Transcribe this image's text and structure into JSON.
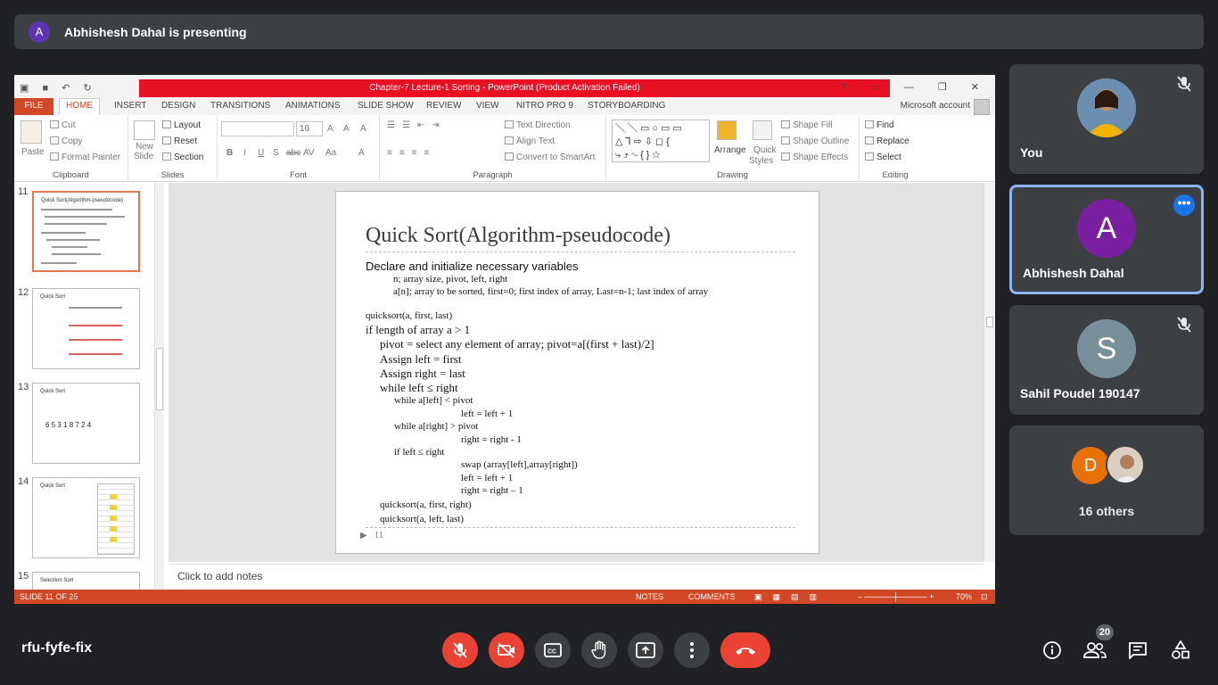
{
  "presenter_bar": {
    "avatar_letter": "A",
    "text": "Abhishesh Dahal is presenting"
  },
  "powerpoint": {
    "window_title": "Chapter-7 Lecture-1 Sorting -  PowerPoint (Product Activation Failed)",
    "tabs": [
      "FILE",
      "HOME",
      "INSERT",
      "DESIGN",
      "TRANSITIONS",
      "ANIMATIONS",
      "SLIDE SHOW",
      "REVIEW",
      "VIEW",
      "NITRO PRO 9",
      "STORYBOARDING"
    ],
    "account": "Microsoft account",
    "ribbon": {
      "clipboard": {
        "paste": "Paste",
        "cut": "Cut",
        "copy": "Copy",
        "format_painter": "Format Painter",
        "label": "Clipboard"
      },
      "slides": {
        "new_slide_1": "New",
        "new_slide_2": "Slide",
        "layout": "Layout",
        "reset": "Reset",
        "section": "Section",
        "label": "Slides"
      },
      "font": {
        "size": "16",
        "bold": "B",
        "italic": "I",
        "underline": "U",
        "strike": "S",
        "shadow": "abc",
        "spacing": "AV",
        "case": "Aa",
        "color": "A",
        "grow": "A",
        "shrink": "A",
        "clear": "A",
        "label": "Font"
      },
      "paragraph": {
        "text_direction": "Text Direction",
        "align_text": "Align Text",
        "convert_smartart": "Convert to SmartArt",
        "label": "Paragraph"
      },
      "drawing": {
        "arrange": "Arrange",
        "quick_styles_1": "Quick",
        "quick_styles_2": "Styles",
        "shape_fill": "Shape Fill",
        "shape_outline": "Shape Outline",
        "shape_effects": "Shape Effects",
        "label": "Drawing"
      },
      "editing": {
        "find": "Find",
        "replace": "Replace",
        "select": "Select",
        "label": "Editing"
      }
    },
    "thumbnails": [
      {
        "num": "11",
        "title": "Quick Sort(Algorithm-pseudocode)"
      },
      {
        "num": "12",
        "title": "Quick Sort"
      },
      {
        "num": "13",
        "title": "Quick Sort",
        "body": "6  5  3  1  8  7  2  4"
      },
      {
        "num": "14",
        "title": "Quick Sort"
      },
      {
        "num": "15",
        "title": "Selection Sort"
      }
    ],
    "slide": {
      "title": "Quick Sort(Algorithm-pseudocode)",
      "lines": [
        "Declare and initialize necessary variables",
        "n; array size, pivot, left, right",
        "a[n]; array to be sorted, first=0; first index of array, Last=n-1; last index of array",
        "quicksort(a, first, last)",
        "if length of array a > 1",
        "pivot = select any element of array; pivot=a[(first + last)/2]",
        "Assign left = first",
        "Assign right = last",
        "while left ≤ right",
        "while a[left] < pivot",
        "left = left + 1",
        "while a[right] > pivot",
        "right = right - 1",
        "if left ≤ right",
        "swap (array[left],array[right])",
        "left = left + 1",
        "right = right – 1",
        "quicksort(a, first, right)",
        "quicksort(a, left, last)"
      ],
      "footer": "11"
    },
    "notes_placeholder": "Click to add notes",
    "status": {
      "slide_info": "SLIDE 11 OF 25",
      "notes": "NOTES",
      "comments": "COMMENTS",
      "zoom": "70%"
    }
  },
  "participants": [
    {
      "name": "You",
      "muted": true
    },
    {
      "name": "Abhishesh Dahal",
      "letter": "A",
      "color": "#7b1fa2",
      "active": true
    },
    {
      "name": "Sahil Poudel 190147",
      "letter": "S",
      "color": "#78909c",
      "muted": true
    },
    {
      "name": "16 others",
      "letter": "D",
      "color": "#e8710a"
    }
  ],
  "meeting": {
    "code": "rfu-fyfe-fix",
    "participant_count": "20"
  },
  "icons": [
    "mic-off-icon",
    "camera-off-icon",
    "captions-icon",
    "raise-hand-icon",
    "present-icon",
    "more-vert-icon",
    "end-call-icon",
    "info-icon",
    "people-icon",
    "chat-icon",
    "activities-icon"
  ]
}
